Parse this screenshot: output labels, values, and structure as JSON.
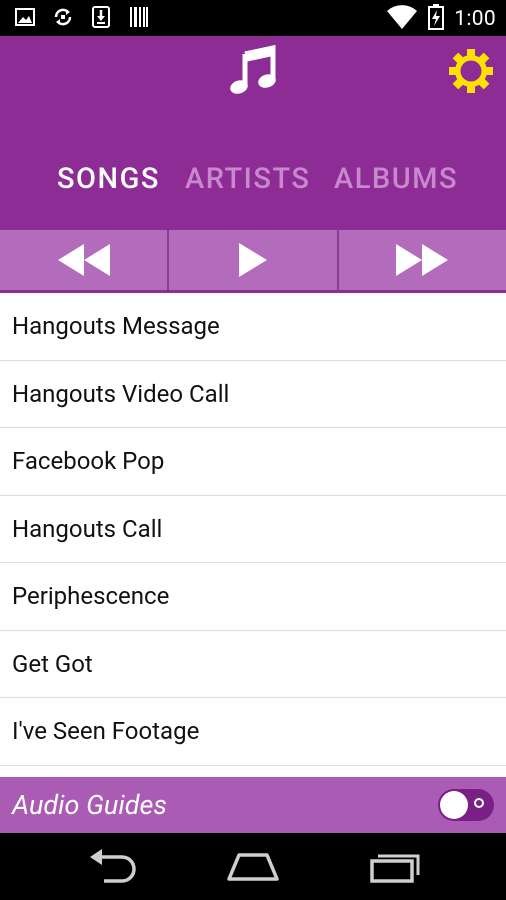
{
  "status_bar": {
    "time": "1:00",
    "left_icons": [
      "image-notification-icon",
      "sync-notification-icon",
      "download-notification-icon",
      "barcode-notification-icon"
    ],
    "right_icons": [
      "wifi-icon",
      "battery-icon"
    ]
  },
  "header": {
    "background": "#8e2c96",
    "icons": [
      "music-note-icon",
      "gear-icon"
    ],
    "tabs": [
      {
        "label": "SONGS",
        "active": true
      },
      {
        "label": "ARTISTS",
        "active": false
      },
      {
        "label": "ALBUMS",
        "active": false
      }
    ]
  },
  "controls": {
    "icons": [
      "rewind-icon",
      "play-icon",
      "fast-forward-icon"
    ]
  },
  "songs": [
    {
      "title": "Hangouts Message"
    },
    {
      "title": "Hangouts Video Call"
    },
    {
      "title": "Facebook Pop"
    },
    {
      "title": "Hangouts Call"
    },
    {
      "title": "Periphescence"
    },
    {
      "title": "Get Got"
    },
    {
      "title": "I've Seen Footage"
    }
  ],
  "audio_guides": {
    "label": "Audio Guides",
    "toggle_on": false
  },
  "nav_bar": {
    "icons": [
      "back-icon",
      "home-icon",
      "recent-apps-icon"
    ]
  },
  "colors": {
    "header_purple": "#8e2c96",
    "controls_purple": "#b36cbb",
    "guides_purple": "#aa5bb3",
    "gear_yellow": "#ffe100",
    "tab_inactive": "#c789cc"
  }
}
